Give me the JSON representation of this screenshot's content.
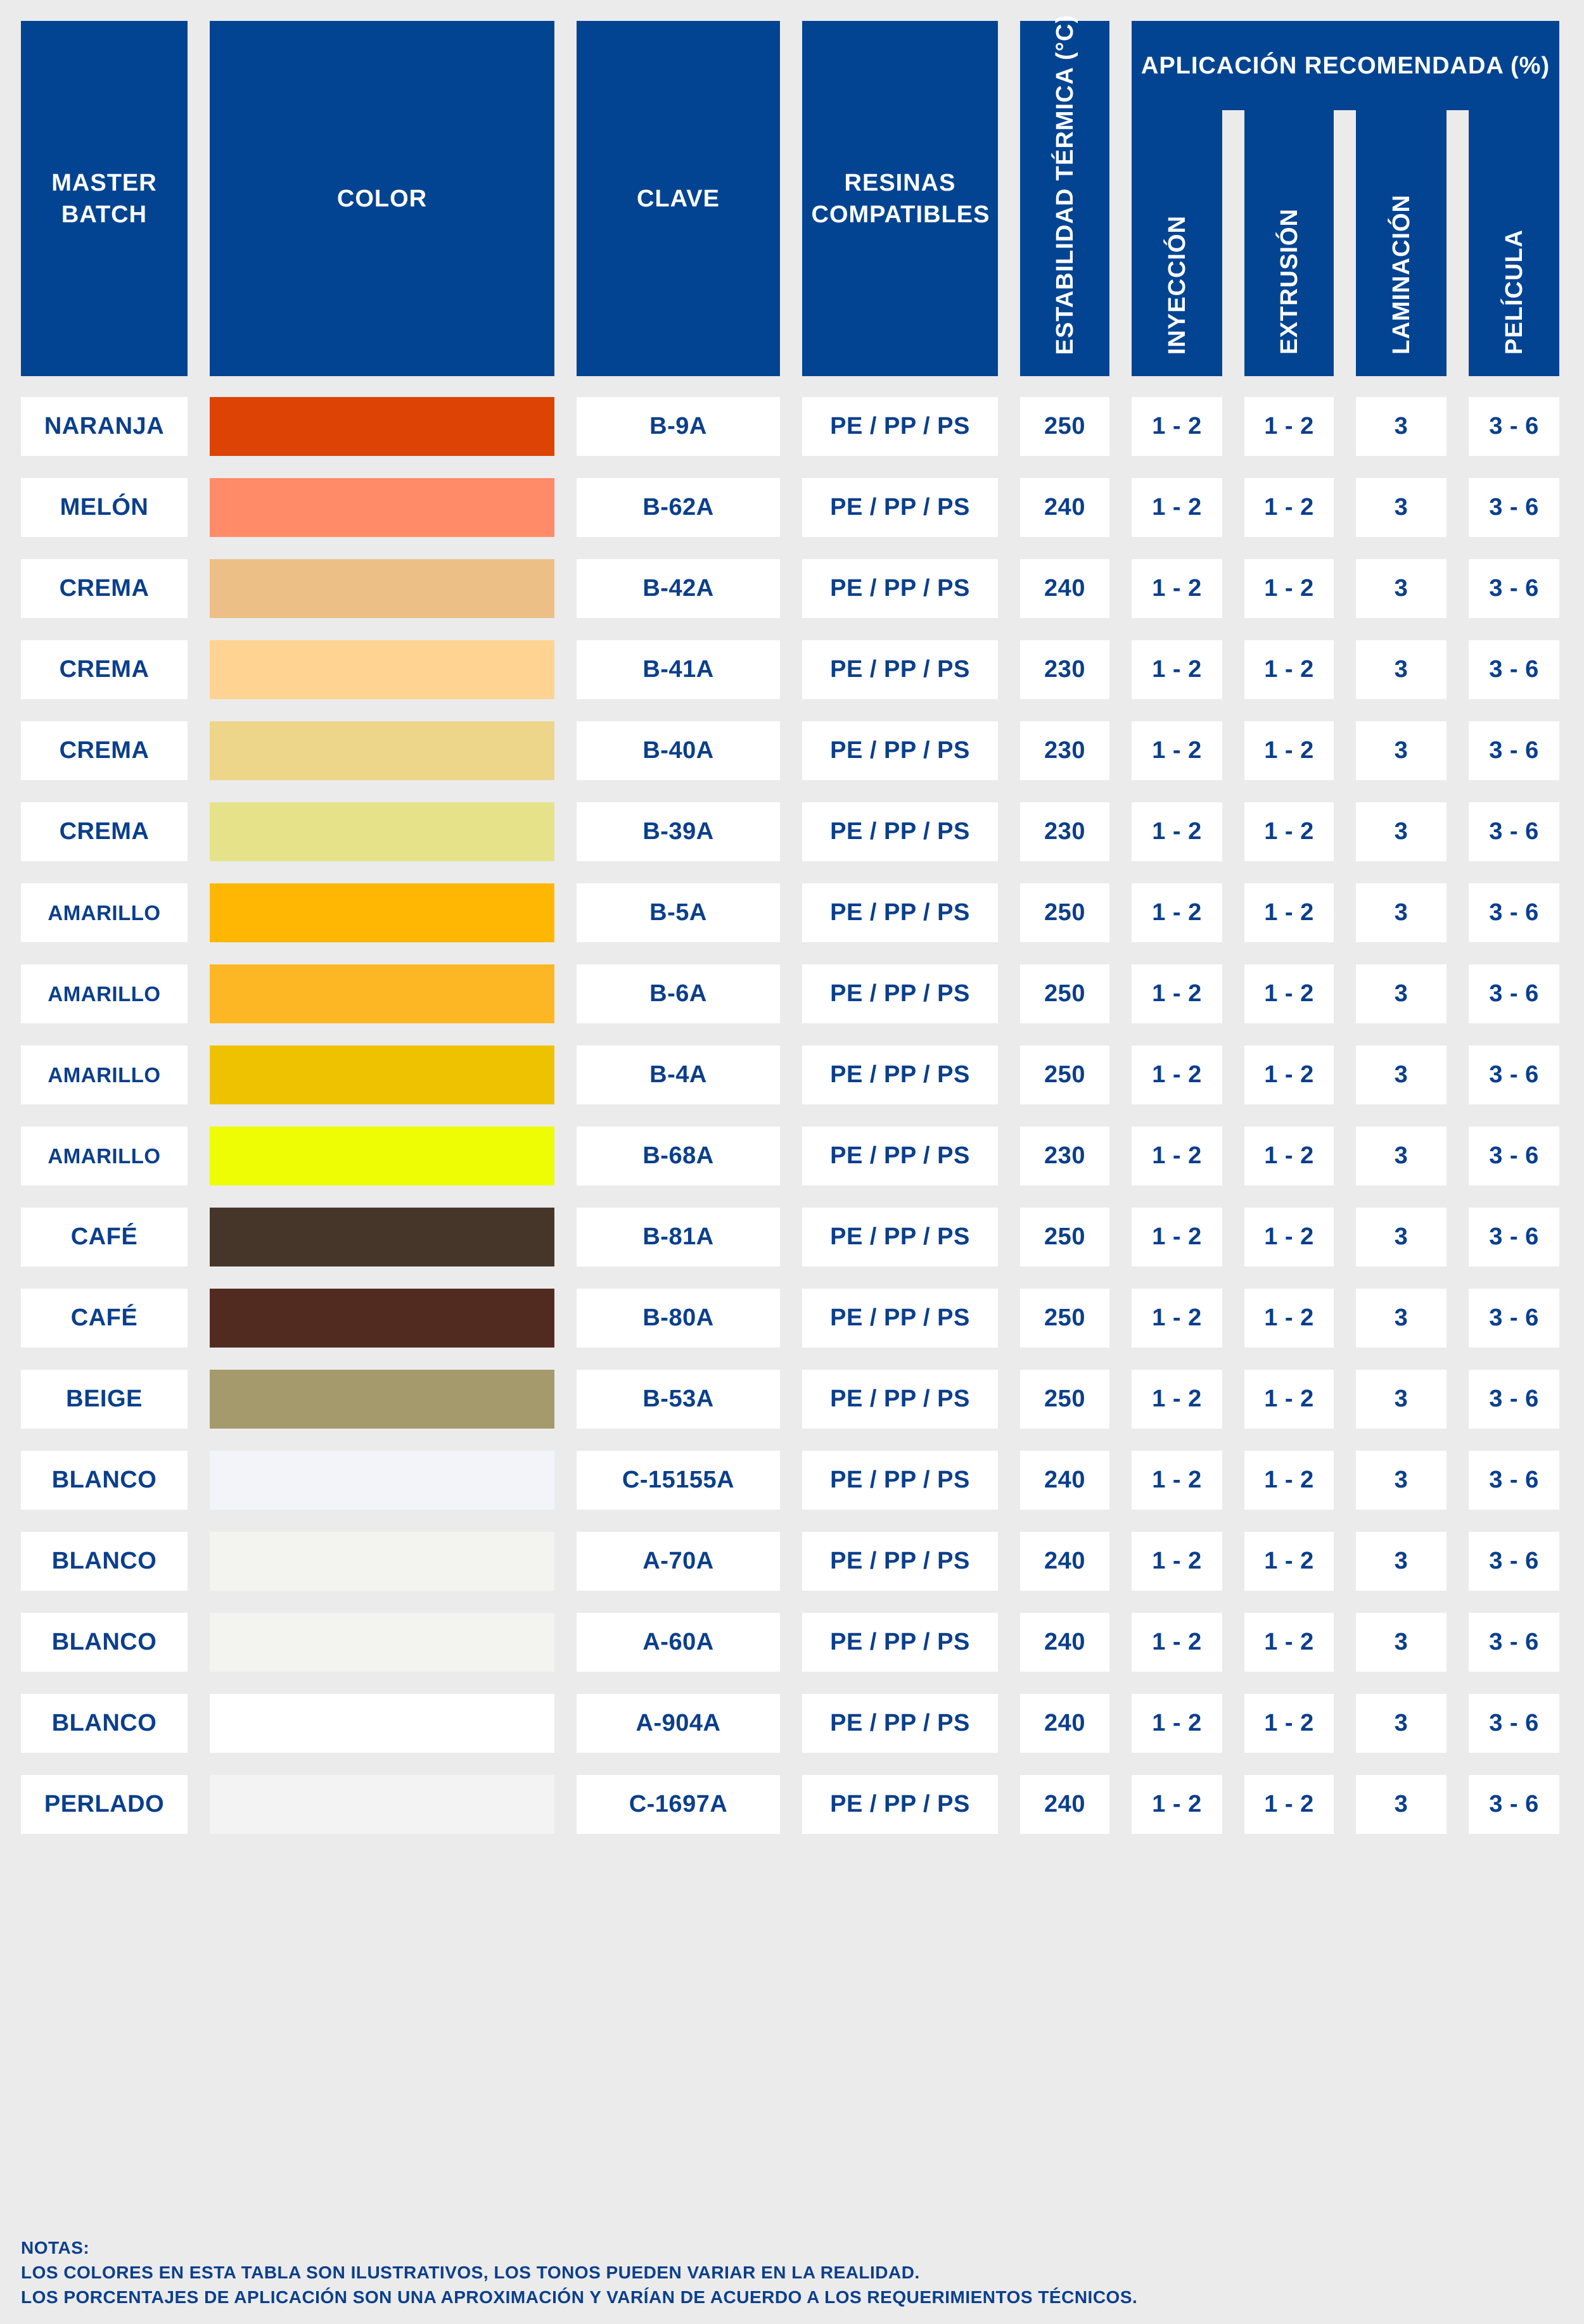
{
  "headers": {
    "master_batch": "MASTER BATCH",
    "color": "COLOR",
    "clave": "CLAVE",
    "resinas": "RESINAS COMPATIBLES",
    "estabilidad": "ESTABILIDAD TÉRMICA (°C)",
    "aplicacion": "APLICACIÓN RECOMENDADA (%)",
    "inyeccion": "INYECCIÓN",
    "extrusion": "EXTRUSIÓN",
    "laminacion": "LAMINACIÓN",
    "pelicula": "PELÍCULA"
  },
  "rows": [
    {
      "name": "NARANJA",
      "color": "#dc4305",
      "clave": "B-9A",
      "resinas": "PE / PP / PS",
      "temp": "250",
      "iny": "1 - 2",
      "ext": "1 - 2",
      "lam": "3",
      "pel": "3 - 6"
    },
    {
      "name": "MELÓN",
      "color": "#ff8b69",
      "clave": "B-62A",
      "resinas": "PE / PP / PS",
      "temp": "240",
      "iny": "1 - 2",
      "ext": "1 - 2",
      "lam": "3",
      "pel": "3 - 6"
    },
    {
      "name": "CREMA",
      "color": "#ecbf86",
      "clave": "B-42A",
      "resinas": "PE / PP / PS",
      "temp": "240",
      "iny": "1 - 2",
      "ext": "1 - 2",
      "lam": "3",
      "pel": "3 - 6"
    },
    {
      "name": "CREMA",
      "color": "#ffd493",
      "clave": "B-41A",
      "resinas": "PE / PP / PS",
      "temp": "230",
      "iny": "1 - 2",
      "ext": "1 - 2",
      "lam": "3",
      "pel": "3 - 6"
    },
    {
      "name": "CREMA",
      "color": "#edd68a",
      "clave": "B-40A",
      "resinas": "PE / PP / PS",
      "temp": "230",
      "iny": "1 - 2",
      "ext": "1 - 2",
      "lam": "3",
      "pel": "3 - 6"
    },
    {
      "name": "CREMA",
      "color": "#e6e28a",
      "clave": "B-39A",
      "resinas": "PE / PP / PS",
      "temp": "230",
      "iny": "1 - 2",
      "ext": "1 - 2",
      "lam": "3",
      "pel": "3 - 6"
    },
    {
      "name": "AMARILLO",
      "color": "#ffb704",
      "clave": "B-5A",
      "resinas": "PE / PP / PS",
      "temp": "250",
      "iny": "1 - 2",
      "ext": "1 - 2",
      "lam": "3",
      "pel": "3 - 6"
    },
    {
      "name": "AMARILLO",
      "color": "#fdb624",
      "clave": "B-6A",
      "resinas": "PE / PP / PS",
      "temp": "250",
      "iny": "1 - 2",
      "ext": "1 - 2",
      "lam": "3",
      "pel": "3 - 6"
    },
    {
      "name": "AMARILLO",
      "color": "#eec201",
      "clave": "B-4A",
      "resinas": "PE / PP / PS",
      "temp": "250",
      "iny": "1 - 2",
      "ext": "1 - 2",
      "lam": "3",
      "pel": "3 - 6"
    },
    {
      "name": "AMARILLO",
      "color": "#eefd03",
      "clave": "B-68A",
      "resinas": "PE / PP / PS",
      "temp": "230",
      "iny": "1 - 2",
      "ext": "1 - 2",
      "lam": "3",
      "pel": "3 - 6"
    },
    {
      "name": "CAFÉ",
      "color": "#46362a",
      "clave": "B-81A",
      "resinas": "PE / PP / PS",
      "temp": "250",
      "iny": "1 - 2",
      "ext": "1 - 2",
      "lam": "3",
      "pel": "3 - 6"
    },
    {
      "name": "CAFÉ",
      "color": "#522b20",
      "clave": "B-80A",
      "resinas": "PE / PP / PS",
      "temp": "250",
      "iny": "1 - 2",
      "ext": "1 - 2",
      "lam": "3",
      "pel": "3 - 6"
    },
    {
      "name": "BEIGE",
      "color": "#a59a6c",
      "clave": "B-53A",
      "resinas": "PE / PP / PS",
      "temp": "250",
      "iny": "1 - 2",
      "ext": "1 - 2",
      "lam": "3",
      "pel": "3 - 6"
    },
    {
      "name": "BLANCO",
      "color": "#f2f4f9",
      "clave": "C-15155A",
      "resinas": "PE / PP / PS",
      "temp": "240",
      "iny": "1 - 2",
      "ext": "1 - 2",
      "lam": "3",
      "pel": "3 - 6"
    },
    {
      "name": "BLANCO",
      "color": "#f3f3ef",
      "clave": "A-70A",
      "resinas": "PE / PP / PS",
      "temp": "240",
      "iny": "1 - 2",
      "ext": "1 - 2",
      "lam": "3",
      "pel": "3 - 6"
    },
    {
      "name": "BLANCO",
      "color": "#f3f4ef",
      "clave": "A-60A",
      "resinas": "PE / PP / PS",
      "temp": "240",
      "iny": "1 - 2",
      "ext": "1 - 2",
      "lam": "3",
      "pel": "3 - 6"
    },
    {
      "name": "BLANCO",
      "color": "#ffffff",
      "clave": "A-904A",
      "resinas": "PE / PP / PS",
      "temp": "240",
      "iny": "1 - 2",
      "ext": "1 - 2",
      "lam": "3",
      "pel": "3 - 6"
    },
    {
      "name": "PERLADO",
      "color": "#f3f3f3",
      "clave": "C-1697A",
      "resinas": "PE / PP / PS",
      "temp": "240",
      "iny": "1 - 2",
      "ext": "1 - 2",
      "lam": "3",
      "pel": "3 - 6"
    }
  ],
  "notes": {
    "title": "NOTAS:",
    "line1": "LOS COLORES EN ESTA TABLA SON ILUSTRATIVOS, LOS TONOS PUEDEN VARIAR EN LA REALIDAD.",
    "line2": "LOS PORCENTAJES DE APLICACIÓN SON UNA APROXIMACIÓN Y VARÍAN DE ACUERDO A LOS REQUERIMIENTOS TÉCNICOS."
  },
  "colors": {
    "header_bg": "#034492",
    "text": "#0b3f8c",
    "page_bg": "#ebebeb"
  }
}
